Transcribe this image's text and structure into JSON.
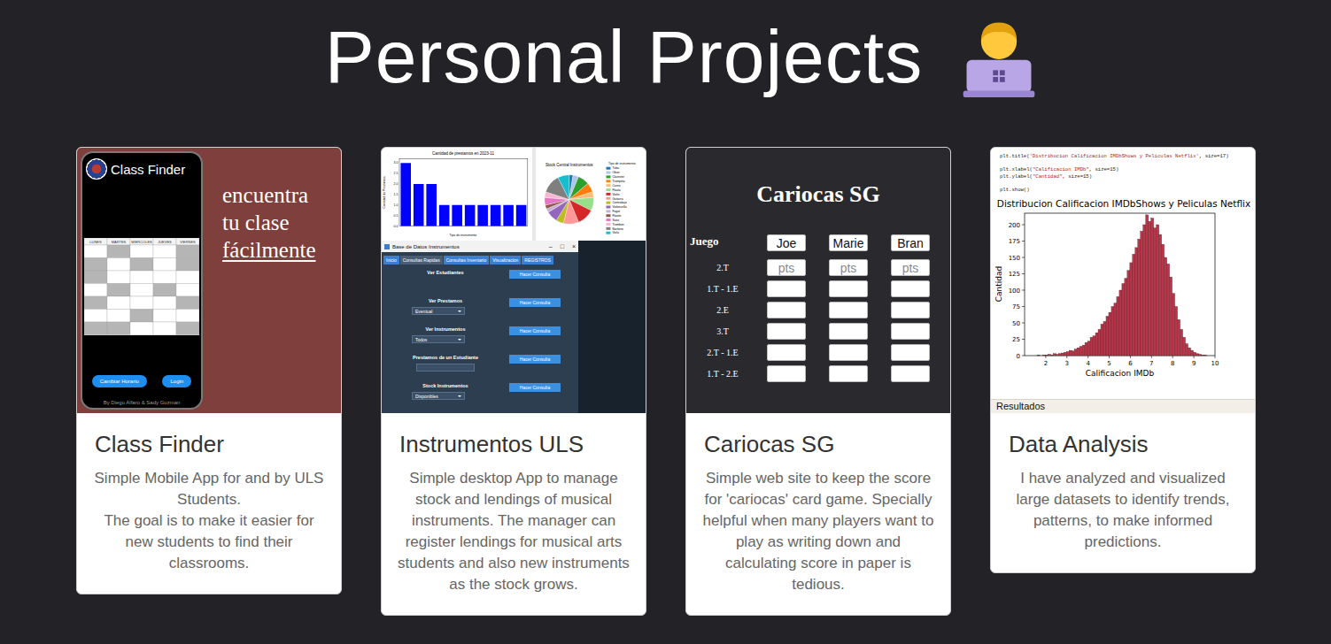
{
  "page": {
    "title": "Personal Projects"
  },
  "projects": [
    {
      "kind": "mobile",
      "title": "Class Finder",
      "description": [
        "Simple Mobile App for and by ULS Students.",
        "The goal is to make it easier for new students to find their classrooms."
      ],
      "preview": {
        "app_title": "Class Finder",
        "tagline": [
          {
            "text": "encuentra",
            "underlined": false
          },
          {
            "text": "tu clase",
            "underlined": false
          },
          {
            "text": "fácilmente",
            "underlined": true
          }
        ],
        "days": [
          "LUNES",
          "MARTES",
          "MIERCOLES",
          "JUEVES",
          "VIERNES"
        ],
        "slots": [
          [
            false,
            true,
            false,
            false,
            true
          ],
          [
            true,
            false,
            true,
            false,
            true
          ],
          [
            true,
            false,
            false,
            false,
            false
          ],
          [
            false,
            true,
            false,
            true,
            false
          ],
          [
            true,
            false,
            false,
            false,
            true
          ],
          [
            false,
            false,
            true,
            false,
            false
          ],
          [
            true,
            true,
            false,
            false,
            true
          ]
        ],
        "buttons": [
          "Cambiar Horario",
          "Login"
        ],
        "credit": "By Diego Alfaro & Sady Guzman"
      }
    },
    {
      "kind": "desktop",
      "title": "Instrumentos ULS",
      "description": [
        "Simple desktop App to manage stock and lendings of musical instruments. The manager can register lendings for musical arts students and also new instruments as the stock grows."
      ],
      "preview": {
        "bar_chart": {
          "title": "Cantidad de prestamos en 2023-11",
          "xlabel": "Tipo de instrumento",
          "ylabel": "Cantidad de Prestamos",
          "yticks": [
            "0.0",
            "0.5",
            "1.0",
            "1.5",
            "2.0",
            "2.5",
            "3.0"
          ],
          "values": [
            3,
            2,
            2,
            1,
            1,
            1,
            1,
            1,
            1,
            1
          ]
        },
        "pie_chart": {
          "title": "Stock Central Instrumentos",
          "legend_title": "Tipo de instrumento",
          "slices": [
            {
              "label": "Tuba",
              "value": 2,
              "color": "#1f77b4"
            },
            {
              "label": "Oboe",
              "value": 3,
              "color": "#aec7e8"
            },
            {
              "label": "Clarinete",
              "value": 6,
              "color": "#2ca02c"
            },
            {
              "label": "Trompeta",
              "value": 5,
              "color": "#ff7f0e"
            },
            {
              "label": "Corno",
              "value": 3,
              "color": "#ffbb78"
            },
            {
              "label": "Flauta",
              "value": 7,
              "color": "#98df8a"
            },
            {
              "label": "Violin",
              "value": 9,
              "color": "#d62728"
            },
            {
              "label": "Guitarra",
              "value": 8,
              "color": "#ff9896"
            },
            {
              "label": "Contrabajo",
              "value": 4,
              "color": "#bcbd22"
            },
            {
              "label": "Violoncello",
              "value": 6,
              "color": "#9467bd"
            },
            {
              "label": "Fagot",
              "value": 2,
              "color": "#c5b0d5"
            },
            {
              "label": "Flautin",
              "value": 2,
              "color": "#8c564b"
            },
            {
              "label": "Saxo",
              "value": 4,
              "color": "#e377c2"
            },
            {
              "label": "Trombon",
              "value": 3,
              "color": "#f7b6d2"
            },
            {
              "label": "Baritono",
              "value": 10,
              "color": "#7f7f7f"
            },
            {
              "label": "Viola",
              "value": 6,
              "color": "#17becf"
            }
          ]
        },
        "app": {
          "title": "Base de Datos Instrumentos",
          "controls": [
            "–",
            "□",
            "×"
          ],
          "tabs": [
            {
              "label": "Inicio",
              "selected": false
            },
            {
              "label": "Consultas Rapidas",
              "selected": true
            },
            {
              "label": "Consultas Inventario",
              "selected": false
            },
            {
              "label": "Visualizacion",
              "selected": false
            },
            {
              "label": "REGISTROS",
              "selected": false
            }
          ],
          "rows": [
            {
              "label": "Ver Estudiantes",
              "kind": "button",
              "value": "",
              "button": "Hacer Consulta"
            },
            {
              "label": "Ver Prestamos",
              "kind": "select",
              "value": "Eventual",
              "button": "Hacer Consulta"
            },
            {
              "label": "Ver Instrumentos",
              "kind": "select",
              "value": "Todos",
              "button": "Hacer Consulta"
            },
            {
              "label": "Prestamos de un Estudiante",
              "kind": "input",
              "value": "",
              "button": "Hacer Consulta"
            },
            {
              "label": "Stock Instrumentos",
              "kind": "select",
              "value": "Disponibles",
              "button": "Hacer Consulta"
            }
          ]
        }
      }
    },
    {
      "kind": "web",
      "title": "Cariocas SG",
      "description": [
        "Simple web site to keep the score for 'cariocas' card game. Specially helpful when many players want to play as writing down and calculating score in paper is tedious."
      ],
      "preview": {
        "title": "Cariocas SG",
        "header": "Juego",
        "players": [
          "Joe",
          "Marie",
          "Bran"
        ],
        "rounds": [
          {
            "label": "2.T",
            "placeholder": "pts"
          },
          {
            "label": "1.T - 1.E",
            "placeholder": ""
          },
          {
            "label": "2.E",
            "placeholder": ""
          },
          {
            "label": "3.T",
            "placeholder": ""
          },
          {
            "label": "2.T - 1.E",
            "placeholder": ""
          },
          {
            "label": "1.T - 2.E",
            "placeholder": ""
          }
        ]
      }
    },
    {
      "kind": "analysis",
      "title": "Data Analysis",
      "description": [
        "I have analyzed and visualized large datasets to identify trends, patterns, to make informed predictions."
      ],
      "preview": {
        "code": [
          [
            {
              "text": "plt.title(",
              "kind": "plain"
            },
            {
              "text": "'Distribucion Calificacion IMDbShows y Peliculas Netflix'",
              "kind": "string"
            },
            {
              "text": ", size=17)",
              "kind": "plain"
            }
          ],
          [],
          [
            {
              "text": "plt.xlabel(",
              "kind": "plain"
            },
            {
              "text": "\"Calificacion IMDb\"",
              "kind": "string"
            },
            {
              "text": ", size=15)",
              "kind": "plain"
            }
          ],
          [
            {
              "text": "plt.ylabel(",
              "kind": "plain"
            },
            {
              "text": "\"Cantidad\"",
              "kind": "string"
            },
            {
              "text": ", size=15)",
              "kind": "plain"
            }
          ],
          [],
          [
            {
              "text": "plt.show()",
              "kind": "plain"
            }
          ]
        ],
        "chart": {
          "title": "Distribucion Calificacion IMDbShows y Peliculas Netflix",
          "xlabel": "Calificacion IMDb",
          "ylabel": "Cantidad",
          "xticks": [
            "2",
            "3",
            "4",
            "5",
            "6",
            "7",
            "8",
            "9",
            "10"
          ],
          "yticks": [
            "0",
            "25",
            "50",
            "75",
            "100",
            "125",
            "150",
            "175",
            "200"
          ],
          "values": [
            1,
            0,
            1,
            1,
            2,
            1,
            3,
            2,
            3,
            4,
            5,
            6,
            8,
            7,
            10,
            12,
            14,
            16,
            20,
            22,
            28,
            30,
            35,
            40,
            48,
            52,
            60,
            66,
            75,
            80,
            90,
            100,
            110,
            118,
            130,
            142,
            155,
            165,
            178,
            190,
            200,
            215,
            205,
            210,
            195,
            200,
            185,
            170,
            150,
            140,
            120,
            95,
            75,
            55,
            40,
            28,
            18,
            12,
            8,
            5,
            3,
            2,
            1,
            1
          ]
        },
        "footer": "Resultados"
      }
    }
  ]
}
